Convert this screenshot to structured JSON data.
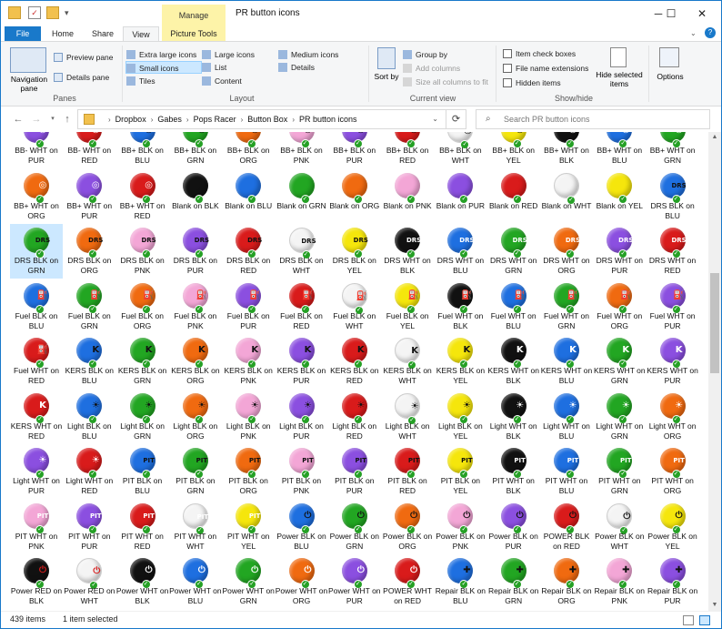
{
  "window": {
    "title": "PR button icons",
    "manage_tab": "Manage",
    "controls": {
      "minimize": "─",
      "maximize": "☐",
      "close": "✕"
    }
  },
  "tabs": {
    "file": "File",
    "home": "Home",
    "share": "Share",
    "view": "View",
    "picture_tools": "Picture Tools"
  },
  "ribbon": {
    "panes": {
      "label": "Panes",
      "navigation_pane": "Navigation pane",
      "preview_pane": "Preview pane",
      "details_pane": "Details pane"
    },
    "layout": {
      "label": "Layout",
      "extra_large": "Extra large icons",
      "large": "Large icons",
      "medium": "Medium icons",
      "small": "Small icons",
      "list": "List",
      "details": "Details",
      "tiles": "Tiles",
      "content": "Content"
    },
    "current_view": {
      "label": "Current view",
      "sort_by": "Sort by",
      "group_by": "Group by",
      "add_columns": "Add columns",
      "size_all": "Size all columns to fit"
    },
    "show_hide": {
      "label": "Show/hide",
      "item_check_boxes": "Item check boxes",
      "file_name_extensions": "File name extensions",
      "hidden_items": "Hidden items",
      "hide_selected": "Hide selected items"
    },
    "options": "Options"
  },
  "address": {
    "crumbs": [
      "Dropbox",
      "Gabes",
      "Pops Racer",
      "Button Box",
      "PR button icons"
    ]
  },
  "search": {
    "placeholder": "Search PR button icons"
  },
  "colors": {
    "BLK": "#111111",
    "BLU": "#1e6fe0",
    "GRN": "#22a622",
    "ORG": "#f06a10",
    "PNK": "#f3a6d6",
    "PUR": "#8b4fe0",
    "RED": "#d91b1b",
    "WHT": "#f4f4f4",
    "YEL": "#f5e60c"
  },
  "rows": [
    [
      [
        "BB- WHT on PUR",
        "PUR"
      ],
      [
        "BB- WHT on RED",
        "RED"
      ],
      [
        "BB+ BLK on BLU",
        "BLU"
      ],
      [
        "BB+ BLK on GRN",
        "GRN"
      ],
      [
        "BB+ BLK on ORG",
        "ORG"
      ],
      [
        "BB+ BLK on PNK",
        "PNK"
      ],
      [
        "BB+ BLK on PUR",
        "PUR"
      ],
      [
        "BB+ BLK on RED",
        "RED"
      ],
      [
        "BB+ BLK on WHT",
        "WHT"
      ],
      [
        "BB+ BLK on YEL",
        "YEL"
      ],
      [
        "BB+ WHT on BLK",
        "BLK"
      ],
      [
        "BB+ WHT on BLU",
        "BLU"
      ],
      [
        "BB+ WHT on GRN",
        "GRN"
      ]
    ],
    [
      [
        "BB+ WHT on ORG",
        "ORG"
      ],
      [
        "BB+ WHT on PUR",
        "PUR"
      ],
      [
        "BB+ WHT on RED",
        "RED"
      ],
      [
        "Blank on BLK",
        "BLK"
      ],
      [
        "Blank on BLU",
        "BLU"
      ],
      [
        "Blank on GRN",
        "GRN"
      ],
      [
        "Blank on ORG",
        "ORG"
      ],
      [
        "Blank on PNK",
        "PNK"
      ],
      [
        "Blank on PUR",
        "PUR"
      ],
      [
        "Blank on RED",
        "RED"
      ],
      [
        "Blank on WHT",
        "WHT"
      ],
      [
        "Blank on YEL",
        "YEL"
      ],
      [
        "DRS BLK on BLU",
        "BLU"
      ]
    ],
    [
      [
        "DRS BLK on GRN",
        "GRN"
      ],
      [
        "DRS BLK on ORG",
        "ORG"
      ],
      [
        "DRS BLK on PNK",
        "PNK"
      ],
      [
        "DRS BLK on PUR",
        "PUR"
      ],
      [
        "DRS BLK on RED",
        "RED"
      ],
      [
        "DRS BLK on WHT",
        "WHT"
      ],
      [
        "DRS BLK on YEL",
        "YEL"
      ],
      [
        "DRS WHT on BLK",
        "BLK"
      ],
      [
        "DRS WHT on BLU",
        "BLU"
      ],
      [
        "DRS WHT on GRN",
        "GRN"
      ],
      [
        "DRS WHT on ORG",
        "ORG"
      ],
      [
        "DRS WHT on PUR",
        "PUR"
      ],
      [
        "DRS WHT on RED",
        "RED"
      ]
    ],
    [
      [
        "Fuel BLK on BLU",
        "BLU"
      ],
      [
        "Fuel BLK on GRN",
        "GRN"
      ],
      [
        "Fuel BLK on ORG",
        "ORG"
      ],
      [
        "Fuel BLK on PNK",
        "PNK"
      ],
      [
        "Fuel BLK on PUR",
        "PUR"
      ],
      [
        "Fuel BLK on RED",
        "RED"
      ],
      [
        "Fuel BLK on WHT",
        "WHT"
      ],
      [
        "Fuel BLK on YEL",
        "YEL"
      ],
      [
        "Fuel WHT on BLK",
        "BLK"
      ],
      [
        "Fuel WHT on BLU",
        "BLU"
      ],
      [
        "Fuel WHT on GRN",
        "GRN"
      ],
      [
        "Fuel WHT on ORG",
        "ORG"
      ],
      [
        "Fuel WHT on PUR",
        "PUR"
      ]
    ],
    [
      [
        "Fuel WHT on RED",
        "RED"
      ],
      [
        "KERS BLK on BLU",
        "BLU"
      ],
      [
        "KERS BLK on GRN",
        "GRN"
      ],
      [
        "KERS BLK on ORG",
        "ORG"
      ],
      [
        "KERS BLK on PNK",
        "PNK"
      ],
      [
        "KERS BLK on PUR",
        "PUR"
      ],
      [
        "KERS BLK on RED",
        "RED"
      ],
      [
        "KERS BLK on WHT",
        "WHT"
      ],
      [
        "KERS BLK on YEL",
        "YEL"
      ],
      [
        "KERS WHT on BLK",
        "BLK"
      ],
      [
        "KERS WHT on BLU",
        "BLU"
      ],
      [
        "KERS WHT on GRN",
        "GRN"
      ],
      [
        "KERS WHT on PUR",
        "PUR"
      ]
    ],
    [
      [
        "KERS WHT on RED",
        "RED"
      ],
      [
        "Light BLK on BLU",
        "BLU"
      ],
      [
        "Light BLK on GRN",
        "GRN"
      ],
      [
        "Light BLK on ORG",
        "ORG"
      ],
      [
        "Light BLK on PNK",
        "PNK"
      ],
      [
        "Light BLK on PUR",
        "PUR"
      ],
      [
        "Light BLK on RED",
        "RED"
      ],
      [
        "Light BLK on WHT",
        "WHT"
      ],
      [
        "Light BLK on YEL",
        "YEL"
      ],
      [
        "Light WHT on BLK",
        "BLK"
      ],
      [
        "Light WHT on BLU",
        "BLU"
      ],
      [
        "Light WHT on GRN",
        "GRN"
      ],
      [
        "Light WHT on ORG",
        "ORG"
      ]
    ],
    [
      [
        "Light WHT on PUR",
        "PUR"
      ],
      [
        "Light WHT on RED",
        "RED"
      ],
      [
        "PIT BLK on BLU",
        "BLU"
      ],
      [
        "PIT BLK on GRN",
        "GRN"
      ],
      [
        "PIT BLK on ORG",
        "ORG"
      ],
      [
        "PIT BLK on PNK",
        "PNK"
      ],
      [
        "PIT BLK on PUR",
        "PUR"
      ],
      [
        "PIT BLK on RED",
        "RED"
      ],
      [
        "PIT BLK on YEL",
        "YEL"
      ],
      [
        "PIT WHT on BLK",
        "BLK"
      ],
      [
        "PIT WHT on BLU",
        "BLU"
      ],
      [
        "PIT WHT on GRN",
        "GRN"
      ],
      [
        "PIT WHT on ORG",
        "ORG"
      ]
    ],
    [
      [
        "PIT WHT on PNK",
        "PNK"
      ],
      [
        "PIT WHT on PUR",
        "PUR"
      ],
      [
        "PIT WHT on RED",
        "RED"
      ],
      [
        "PIT WHT on WHT",
        "WHT"
      ],
      [
        "PIT WHT on YEL",
        "YEL"
      ],
      [
        "Power BLK on BLU",
        "BLU"
      ],
      [
        "Power BLK on GRN",
        "GRN"
      ],
      [
        "Power BLK on ORG",
        "ORG"
      ],
      [
        "Power BLK on PNK",
        "PNK"
      ],
      [
        "Power BLK on PUR",
        "PUR"
      ],
      [
        "POWER BLK on RED",
        "RED"
      ],
      [
        "Power BLK on WHT",
        "WHT"
      ],
      [
        "Power BLK on YEL",
        "YEL"
      ]
    ],
    [
      [
        "Power RED on BLK",
        "BLK"
      ],
      [
        "Power RED on WHT",
        "WHT"
      ],
      [
        "Power WHT on BLK",
        "BLK"
      ],
      [
        "Power WHT on BLU",
        "BLU"
      ],
      [
        "Power WHT on GRN",
        "GRN"
      ],
      [
        "Power WHT on ORG",
        "ORG"
      ],
      [
        "Power WHT on PUR",
        "PUR"
      ],
      [
        "POWER WHT on RED",
        "RED"
      ],
      [
        "Repair BLK on BLU",
        "BLU"
      ],
      [
        "Repair BLK on GRN",
        "GRN"
      ],
      [
        "Repair BLK on ORG",
        "ORG"
      ],
      [
        "Repair BLK on PNK",
        "PNK"
      ],
      [
        "Repair BLK on PUR",
        "PUR"
      ]
    ]
  ],
  "selected": "DRS BLK on GRN",
  "status": {
    "count": "439 items",
    "selected": "1 item selected"
  }
}
